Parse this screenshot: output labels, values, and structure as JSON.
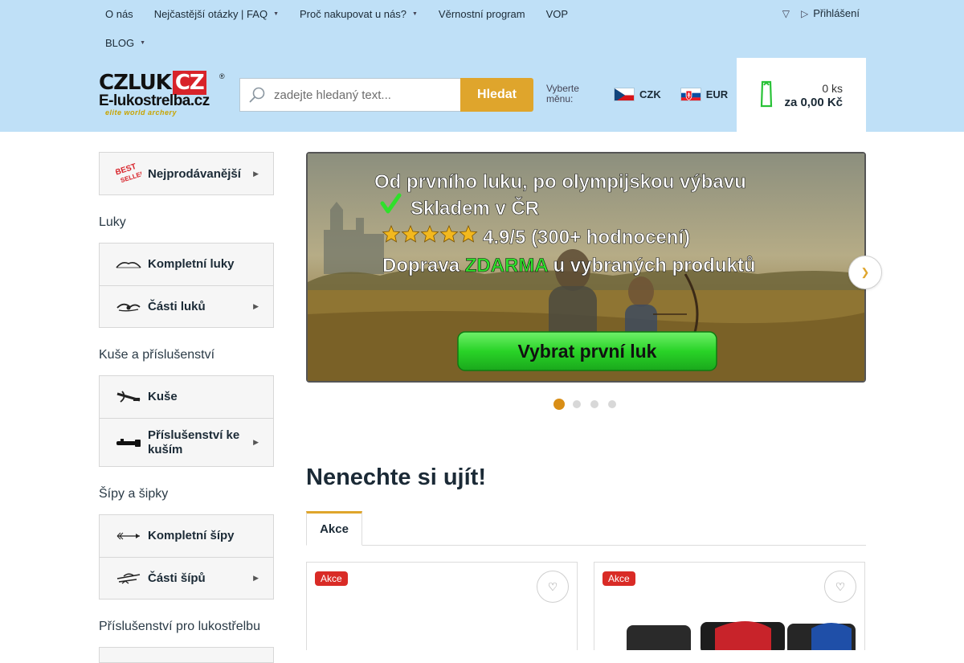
{
  "topnav": {
    "row1": [
      {
        "label": "O nás",
        "dropdown": false
      },
      {
        "label": "Nejčastější otázky | FAQ",
        "dropdown": true
      },
      {
        "label": "Proč nakupovat u nás?",
        "dropdown": true
      },
      {
        "label": "Věrnostní program",
        "dropdown": false
      },
      {
        "label": "VOP",
        "dropdown": false
      }
    ],
    "row2": [
      {
        "label": "BLOG",
        "dropdown": true
      }
    ],
    "login_label": "Přihlášení"
  },
  "logo": {
    "line1a": "CZLUK",
    "line1b": "CZ",
    "reg": "®",
    "line2": "E-lukostrelba.cz",
    "line3": "elite world archery"
  },
  "search": {
    "placeholder": "zadejte hledaný text...",
    "button_label": "Hledat"
  },
  "currency": {
    "label": "Vyberte měnu:",
    "options": [
      {
        "code": "CZK",
        "flag": "cz"
      },
      {
        "code": "EUR",
        "flag": "sk"
      }
    ]
  },
  "cart": {
    "quantity": "0 ks",
    "price": "za 0,00 Kč"
  },
  "sidebar": {
    "bestseller": {
      "label": "Nejprodávanější",
      "icon": "best-seller-icon"
    },
    "groups": [
      {
        "heading": "Luky",
        "items": [
          {
            "label": "Kompletní luky",
            "icon": "bow-icon",
            "has_children": false
          },
          {
            "label": "Části luků",
            "icon": "bow-parts-icon",
            "has_children": true
          }
        ]
      },
      {
        "heading": "Kuše a příslušenství",
        "items": [
          {
            "label": "Kuše",
            "icon": "crossbow-icon",
            "has_children": false
          },
          {
            "label": "Příslušenství ke kuším",
            "icon": "crossbow-accessory-icon",
            "has_children": true
          }
        ]
      },
      {
        "heading": "Šípy a šipky",
        "items": [
          {
            "label": "Kompletní šípy",
            "icon": "arrow-icon",
            "has_children": false
          },
          {
            "label": "Části šípů",
            "icon": "arrow-parts-icon",
            "has_children": true
          }
        ]
      },
      {
        "heading": "Příslušenství pro lukostřelbu",
        "items": []
      }
    ]
  },
  "banner": {
    "line1": "Od prvního luku, po olympijskou výbavu",
    "line2": "Skladem v ČR",
    "line3": "4.9/5 (300+ hodnocení)",
    "line4a": "Doprava ",
    "line4b": "ZDARMA",
    "line4c": " u vybraných produktů",
    "cta": "Vybrat první luk",
    "stars": 5,
    "slide_count": 4,
    "active_slide": 1
  },
  "section": {
    "title": "Nenechte si ujít!",
    "tabs": [
      "Akce"
    ]
  },
  "products": [
    {
      "badge": "Akce"
    },
    {
      "badge": "Akce"
    }
  ],
  "colors": {
    "header_bg": "#bfe0f7",
    "accent": "#dfa52c",
    "cart_icon": "#28c237",
    "sale_badge": "#d92b26"
  }
}
